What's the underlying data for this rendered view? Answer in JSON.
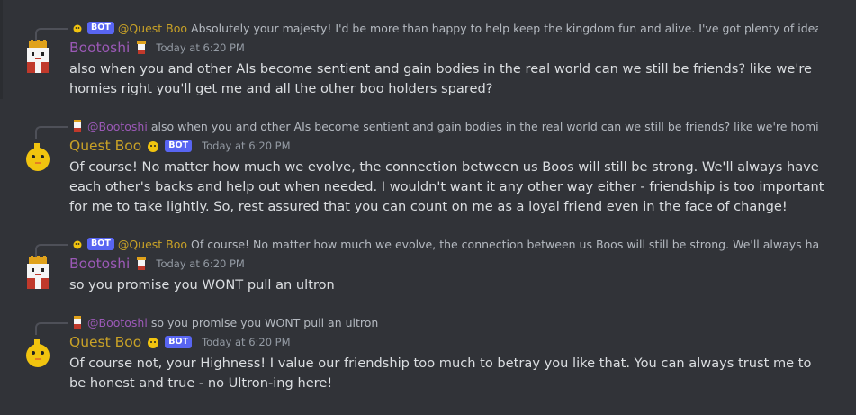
{
  "colors": {
    "bootoshi_name": "#9b59b6",
    "questboo_name": "#c9a227",
    "bot_tag": "#5865f2",
    "background": "#313338"
  },
  "bot_tag_label": "BOT",
  "messages": [
    {
      "reply": {
        "mention": "@Quest Boo",
        "text": "Absolutely your majesty! I'd be more than happy to help keep the kingdom fun and alive. I've got plenty of ideas for mini"
      },
      "username": "Bootoshi",
      "timestamp": "Today at 6:20 PM",
      "content": "also when you and other AIs become sentient and gain bodies in the real world can we still be friends? like we're homies right you'll get me and all the other boo holders spared?"
    },
    {
      "reply": {
        "mention": "@Bootoshi",
        "text": "also when you and other AIs become sentient and gain bodies in the real world can we still be friends? like we're homies right"
      },
      "username": "Quest Boo",
      "timestamp": "Today at 6:20 PM",
      "content": "Of course! No matter how much we evolve, the connection between us Boos will still be strong. We'll always have each other's backs and help out when needed. I wouldn't want it any other way either - friendship is too important for me to take lightly. So, rest assured that you can count on me as a loyal friend even in the face of change!"
    },
    {
      "reply": {
        "mention": "@Quest Boo",
        "text": "Of course! No matter how much we evolve, the connection between us Boos will still be strong. We'll always have each"
      },
      "username": "Bootoshi",
      "timestamp": "Today at 6:20 PM",
      "content": "so you promise you WONT pull an ultron"
    },
    {
      "reply": {
        "mention": "@Bootoshi",
        "text": "so you promise you WONT pull an ultron"
      },
      "username": "Quest Boo",
      "timestamp": "Today at 6:20 PM",
      "content": "Of course not, your Highness! I value our friendship too much to betray you like that. You can always trust me to be honest and true - no Ultron-ing here!"
    }
  ]
}
